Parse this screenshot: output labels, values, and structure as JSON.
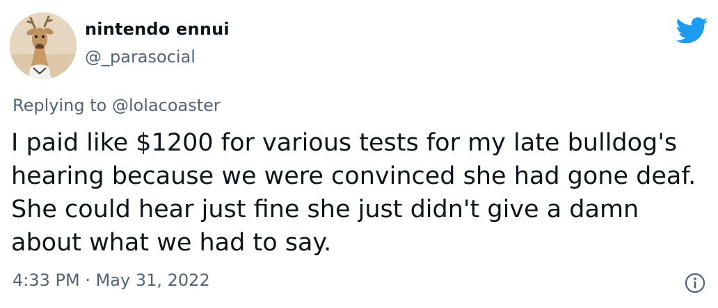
{
  "author": {
    "display_name": "nintendo ennui",
    "handle": "@_parasocial",
    "avatar_icon": "deer-mannequin-avatar"
  },
  "reply": {
    "prefix": "Replying to ",
    "to": "@lolacoaster"
  },
  "tweet": {
    "text": "I paid like $1200 for various tests for my late bulldog's hearing because we were convinced she had gone deaf. She could hear just fine she just didn't give a damn about what we had to say."
  },
  "meta": {
    "time": "4:33 PM",
    "separator": " · ",
    "date": "May 31, 2022"
  },
  "icons": {
    "brand": "twitter-bird-icon",
    "info": "info-icon"
  },
  "colors": {
    "brand_blue": "#1d9bf0",
    "text": "#0f1419",
    "muted": "#536471"
  }
}
